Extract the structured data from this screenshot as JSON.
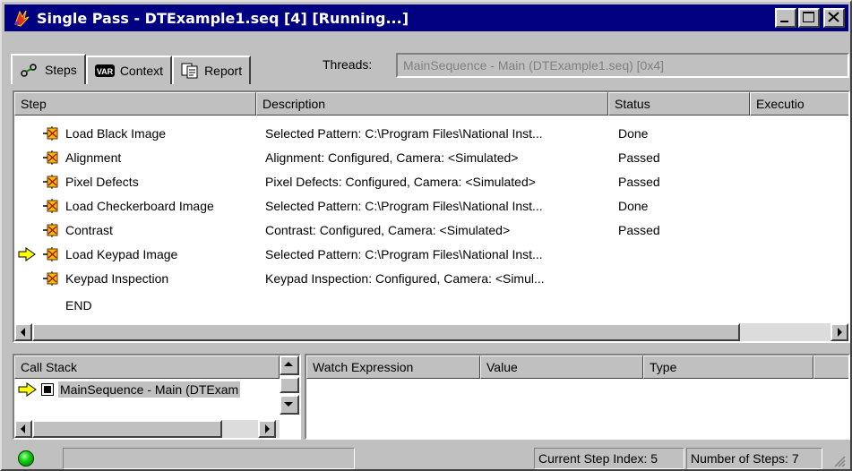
{
  "window": {
    "title": "Single Pass - DTExample1.seq [4] [Running...]"
  },
  "tabs": [
    {
      "label": "Steps",
      "icon": "steps-icon"
    },
    {
      "label": "Context",
      "icon": "var-icon"
    },
    {
      "label": "Report",
      "icon": "report-icon"
    }
  ],
  "threads": {
    "label": "Threads:",
    "value": "MainSequence - Main (DTExample1.seq) [0x4]"
  },
  "steps_table": {
    "columns": [
      "Step",
      "Description",
      "Status",
      "Executio"
    ],
    "rows": [
      {
        "step": "Load Black Image",
        "description": "Selected Pattern: C:\\Program Files\\National Inst...",
        "status": "Done",
        "current": false
      },
      {
        "step": "Alignment",
        "description": "Alignment: Configured, Camera: <Simulated>",
        "status": "Passed",
        "current": false
      },
      {
        "step": "Pixel Defects",
        "description": "Pixel Defects: Configured, Camera: <Simulated>",
        "status": "Passed",
        "current": false
      },
      {
        "step": "Load Checkerboard Image",
        "description": "Selected Pattern: C:\\Program Files\\National Inst...",
        "status": "Done",
        "current": false
      },
      {
        "step": "Contrast",
        "description": "Contrast: Configured, Camera: <Simulated>",
        "status": "Passed",
        "current": false
      },
      {
        "step": "Load Keypad Image",
        "description": "Selected Pattern: C:\\Program Files\\National Inst...",
        "status": "",
        "current": true
      },
      {
        "step": "Keypad Inspection",
        "description": "Keypad Inspection: Configured, Camera: <Simul...",
        "status": "",
        "current": false
      }
    ],
    "end_label": "END"
  },
  "call_stack": {
    "header": "Call Stack",
    "items": [
      "MainSequence - Main (DTExam"
    ]
  },
  "watch": {
    "columns": [
      "Watch Expression",
      "Value",
      "Type"
    ]
  },
  "status_bar": {
    "current_step": "Current Step Index: 5",
    "num_steps": "Number of Steps: 7"
  },
  "colors": {
    "titlebar": "#000080",
    "face": "#c0c0c0",
    "led": "#10d010",
    "arrow": "#ffff00"
  }
}
